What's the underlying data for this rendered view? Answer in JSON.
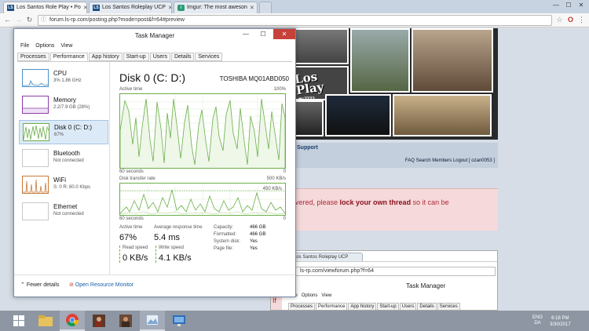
{
  "browser": {
    "tabs": [
      {
        "label": "Los Santos Role Play • Po",
        "favicon": "ls-rp-favicon",
        "active": true
      },
      {
        "label": "Los Santos Roleplay UCP",
        "favicon": "ls-rp-favicon",
        "active": false
      },
      {
        "label": "Imgur: The most aweson",
        "favicon": "imgur-favicon",
        "active": false
      }
    ],
    "url": "forum.ls-rp.com/posting.php?mode=post&f=64#preview",
    "window_controls": {
      "minimize": "—",
      "maximize": "☐",
      "close": "✕"
    }
  },
  "page": {
    "banner": {
      "logo_line1": "Los",
      "logo_line2": "Play",
      "logo_sub": "m:7777"
    },
    "forum_nav": {
      "support": "Support",
      "links": "FAQ   Search   Members   Logout [ ozan0053 ]"
    },
    "warning": {
      "prefix": "vered, please ",
      "bold": "lock your own thread",
      "suffix": " so it can be"
    },
    "inner_screenshot": {
      "tab": "Los Santos Roleplay UCP",
      "url": "ls-rp.com/viewforum.php?f=64",
      "title": "Task Manager",
      "menu": [
        "File",
        "Options",
        "View"
      ],
      "tabs": [
        "Processes",
        "Performance",
        "App history",
        "Start-up",
        "Users",
        "Details",
        "Services"
      ],
      "selected_tab": 1,
      "partial_text": "If"
    }
  },
  "task_manager": {
    "title": "Task Manager",
    "menu": [
      "File",
      "Options",
      "View"
    ],
    "tabs": [
      "Processes",
      "Performance",
      "App history",
      "Start-up",
      "Users",
      "Details",
      "Services"
    ],
    "selected_tab": 1,
    "sidebar": [
      {
        "name": "CPU",
        "value": "3%  1.86 GHz",
        "color": "#4a90c8"
      },
      {
        "name": "Memory",
        "value": "2.2/7.9 GB (28%)",
        "color": "#8b3fa8"
      },
      {
        "name": "Disk 0 (C: D:)",
        "value": "67%",
        "color": "#6cae4a",
        "selected": true
      },
      {
        "name": "Bluetooth",
        "value": "Not connected",
        "color": "#c9c9c9"
      },
      {
        "name": "WiFi",
        "value": "S: 0 R: 80.0 Kbps",
        "color": "#c87a3a"
      },
      {
        "name": "Ethernet",
        "value": "Not connected",
        "color": "#c9c9c9"
      }
    ],
    "detail": {
      "title": "Disk 0 (C: D:)",
      "model": "TOSHIBA MQ01ABD050",
      "graph1_label": "Active time",
      "graph1_max": "100%",
      "graph1_span": "60 seconds",
      "graph1_min": "0",
      "graph2_label": "Disk transfer rate",
      "graph2_max": "500 KB/s",
      "graph2_mid": "450 KB/s",
      "graph2_span": "60 seconds",
      "graph2_min": "0",
      "active_time_label": "Active time",
      "active_time": "67%",
      "response_label": "Average response time",
      "response": "5.4 ms",
      "read_label": "Read speed",
      "read": "0 KB/s",
      "write_label": "Write speed",
      "write": "4.1 KB/s",
      "props": [
        {
          "k": "Capacity:",
          "v": "466 GB"
        },
        {
          "k": "Formatted:",
          "v": "466 GB"
        },
        {
          "k": "System disk:",
          "v": "Yes"
        },
        {
          "k": "Page file:",
          "v": "Yes"
        }
      ]
    },
    "footer": {
      "fewer": "Fewer details",
      "resmon": "Open Resource Monitor"
    }
  },
  "taskbar": {
    "lang_line1": "ENG",
    "lang_line2": "DA",
    "time": "6:18 PM",
    "date": "3/30/2017"
  }
}
